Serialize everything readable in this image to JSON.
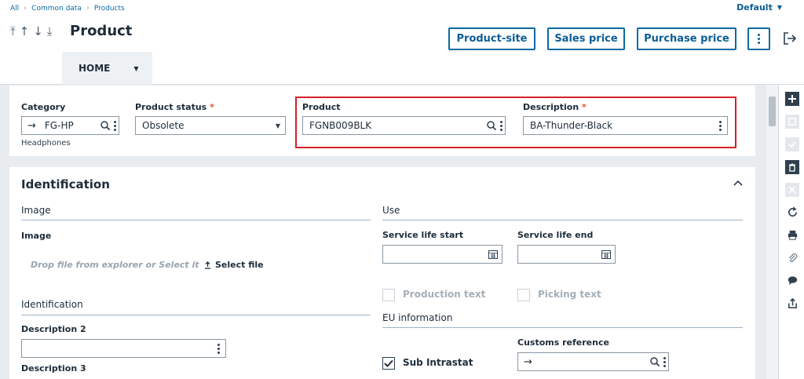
{
  "breadcrumb": {
    "items": [
      "All",
      "Common data",
      "Products"
    ]
  },
  "folder_selector": {
    "label": "Default"
  },
  "page": {
    "title": "Product"
  },
  "header_buttons": {
    "product_site": "Product-site",
    "sales_price": "Sales price",
    "purchase_price": "Purchase price"
  },
  "tabs": {
    "home": "HOME"
  },
  "key_fields": {
    "category": {
      "label": "Category",
      "value": "FG-HP",
      "sublabel": "Headphones"
    },
    "status": {
      "label": "Product status",
      "value": "Obsolete"
    },
    "product": {
      "label": "Product",
      "value": "FGNB009BLK"
    },
    "description": {
      "label": "Description",
      "value": "BA-Thunder-Black"
    },
    "required_mark": "*"
  },
  "identification": {
    "title": "Identification",
    "image_group": "Image",
    "image_label": "Image",
    "drop_hint": "Drop file from explorer or Select it",
    "select_file": "Select file",
    "ident_group": "Identification",
    "description2_label": "Description 2",
    "description3_label": "Description 3",
    "use_group": "Use",
    "service_start_label": "Service life start",
    "service_end_label": "Service life end",
    "production_text": "Production text",
    "picking_text": "Picking text",
    "eu_group": "EU information",
    "sub_intrastat": "Sub Intrastat",
    "sub_intrastat_checked": true,
    "customs_ref_label": "Customs reference"
  },
  "colors": {
    "accent": "#0b6aa2",
    "highlight": "#d6202a",
    "required": "#e2522b"
  }
}
